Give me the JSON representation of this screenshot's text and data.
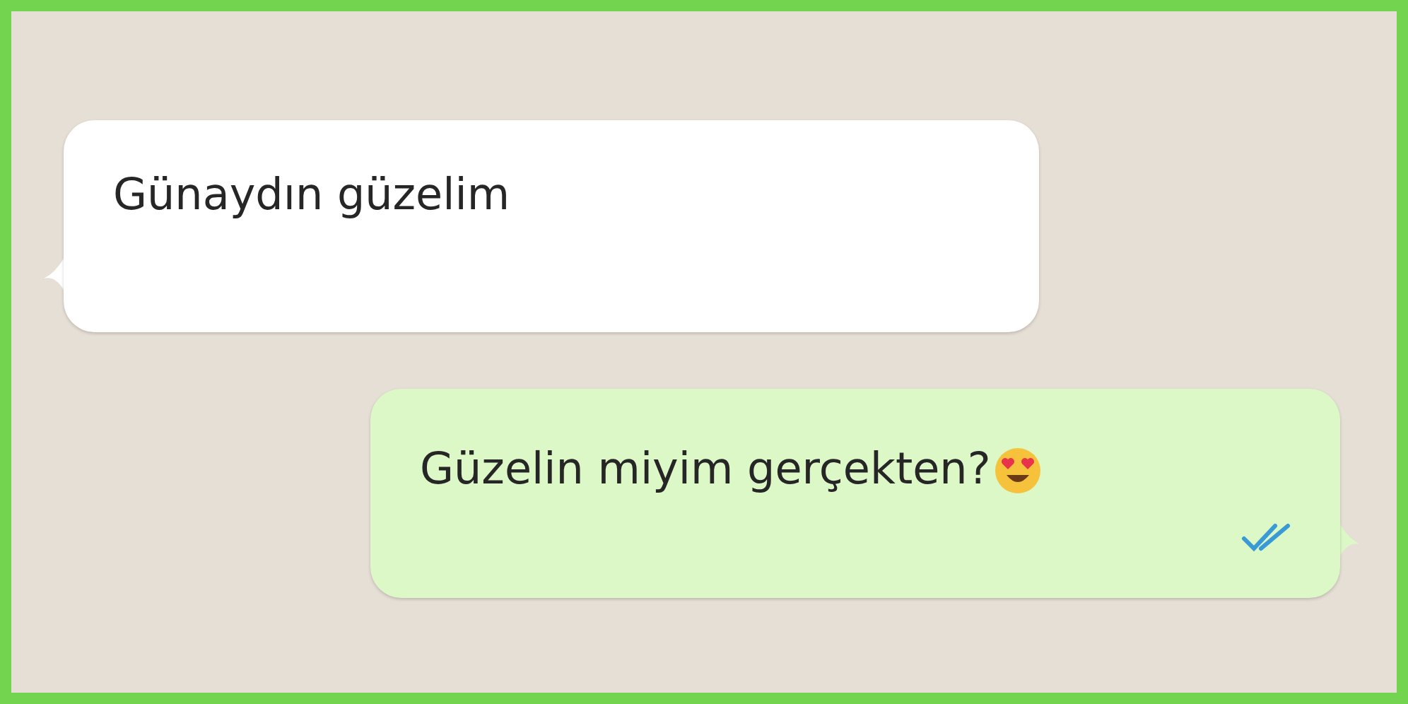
{
  "messages": [
    {
      "kind": "incoming",
      "text": "Günaydın güzelim"
    },
    {
      "kind": "outgoing",
      "text": "Güzelin miyim gerçekten?",
      "emoji": true,
      "read": true
    }
  ]
}
